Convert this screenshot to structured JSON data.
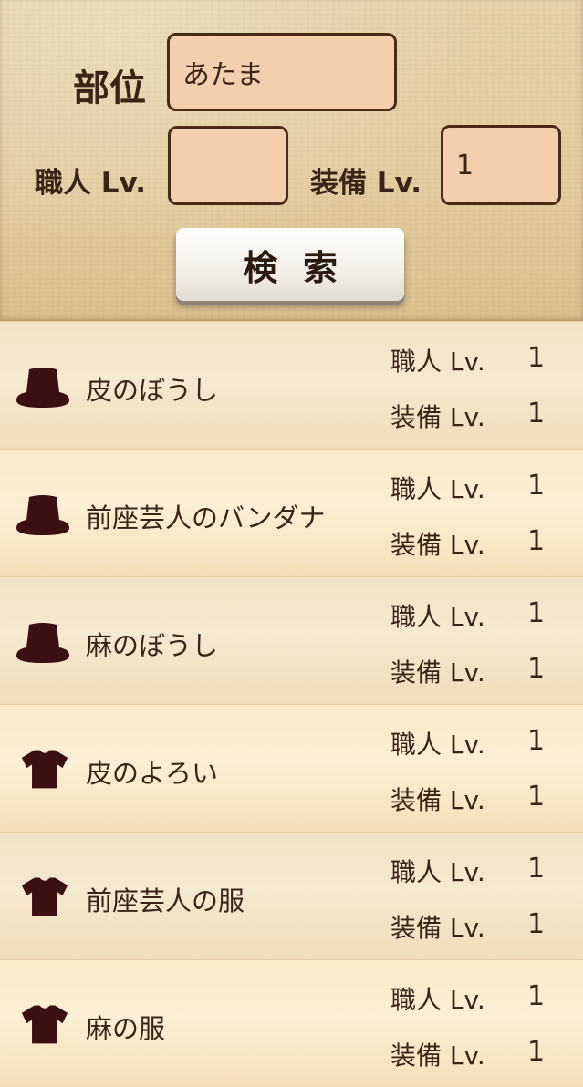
{
  "search": {
    "part_label": "部位",
    "part_value": "あたま",
    "crafter_label": "職人 Lv.",
    "crafter_value": "",
    "equip_label": "装備 Lv.",
    "equip_value": "1",
    "button_label": "検索"
  },
  "results": [
    {
      "icon": "hat-icon",
      "name": "皮のぼうし",
      "crafter_label": "職人 Lv.",
      "crafter_lv": "1",
      "equip_label": "装備 Lv.",
      "equip_lv": "1"
    },
    {
      "icon": "hat-icon",
      "name": "前座芸人のバンダナ",
      "crafter_label": "職人 Lv.",
      "crafter_lv": "1",
      "equip_label": "装備 Lv.",
      "equip_lv": "1"
    },
    {
      "icon": "hat-icon",
      "name": "麻のぼうし",
      "crafter_label": "職人 Lv.",
      "crafter_lv": "1",
      "equip_label": "装備 Lv.",
      "equip_lv": "1"
    },
    {
      "icon": "shirt-icon",
      "name": "皮のよろい",
      "crafter_label": "職人 Lv.",
      "crafter_lv": "1",
      "equip_label": "装備 Lv.",
      "equip_lv": "1"
    },
    {
      "icon": "shirt-icon",
      "name": "前座芸人の服",
      "crafter_label": "職人 Lv.",
      "crafter_lv": "1",
      "equip_label": "装備 Lv.",
      "equip_lv": "1"
    },
    {
      "icon": "shirt-icon",
      "name": "麻の服",
      "crafter_label": "職人 Lv.",
      "crafter_lv": "1",
      "equip_label": "装備 Lv.",
      "equip_lv": "1"
    }
  ]
}
